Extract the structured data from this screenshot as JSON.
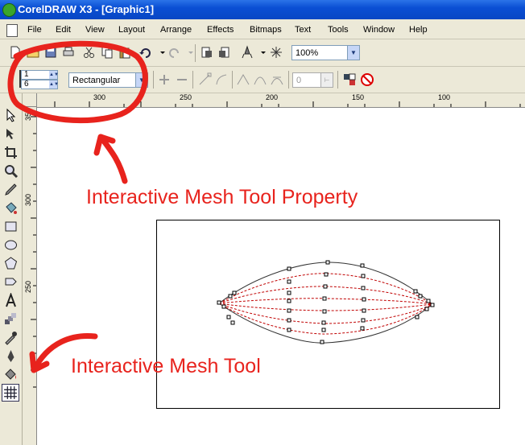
{
  "window": {
    "title": "CorelDRAW X3 - [Graphic1]"
  },
  "menu": [
    "File",
    "Edit",
    "View",
    "Layout",
    "Arrange",
    "Effects",
    "Bitmaps",
    "Text",
    "Tools",
    "Window",
    "Help"
  ],
  "standard_toolbar": {
    "zoom_level": "100%"
  },
  "property_bar": {
    "mesh_columns": "1",
    "mesh_rows": "6",
    "selection_mode": "Rectangular",
    "smoothness_value": "0"
  },
  "rulers": {
    "horizontal_labels": [
      "300",
      "250",
      "200",
      "150",
      "100"
    ],
    "vertical_labels": [
      "350",
      "300",
      "250"
    ]
  },
  "toolbox": {
    "tool_icons": [
      "pick-tool-icon",
      "shape-tool-icon",
      "crop-tool-icon",
      "zoom-tool-icon",
      "freehand-tool-icon",
      "smart-fill-tool-icon",
      "rectangle-tool-icon",
      "ellipse-tool-icon",
      "polygon-tool-icon",
      "basic-shapes-tool-icon",
      "text-tool-icon",
      "interactive-blend-tool-icon",
      "eyedropper-tool-icon",
      "outline-tool-icon",
      "fill-tool-icon",
      "interactive-mesh-tool-icon"
    ],
    "active_tool": "interactive-mesh-tool-icon"
  },
  "annotations": {
    "property_label": "Interactive Mesh Tool Property",
    "tool_label": "Interactive Mesh Tool",
    "color": "#e8231d"
  },
  "colors": {
    "titlebar": "#0a4fd4",
    "mesh_line": "#c00000",
    "chrome": "#ece9d8"
  }
}
